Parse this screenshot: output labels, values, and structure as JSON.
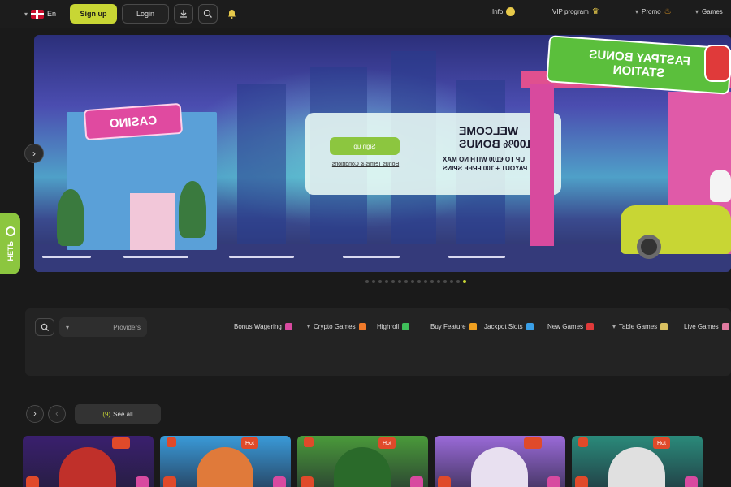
{
  "topbar": {
    "language": "En",
    "signup_label": "Sign up",
    "login_label": "Login",
    "nav": [
      {
        "label": "Info",
        "icon": "info-icon"
      },
      {
        "label": "VIP program",
        "icon": "crown-icon"
      },
      {
        "label": "Promo",
        "icon": "fire-icon"
      },
      {
        "label": "Games",
        "icon": "chevron-down-icon"
      }
    ]
  },
  "hero": {
    "promo_title": "WELCOME 100% BONUS",
    "promo_sub": "UP TO €100 WITH NO MAX PAYOUT + 100 FREE SPINS",
    "promo_button": "Sign up",
    "promo_terms": "Bonus Terms & Conditions",
    "casino_sign": "CASINO",
    "station_sign_line1": "FASTPAY BONUS",
    "station_sign_line2": "STATION"
  },
  "side_tab": {
    "label": "НЕТЬ"
  },
  "carousel": {
    "dot_count": 16,
    "active_index": 15
  },
  "categories": {
    "providers_placeholder": "Providers",
    "items": [
      {
        "label": "Bonus Wagering",
        "color": "#d84aa0"
      },
      {
        "label": "Crypto Games",
        "color": "#f07a2a",
        "dropdown": true
      },
      {
        "label": "Highroll",
        "color": "#3fbf5a"
      },
      {
        "label": "Buy Feature",
        "color": "#f0a020"
      },
      {
        "label": "Jackpot Slots",
        "color": "#3aa0e8"
      },
      {
        "label": "New Games",
        "color": "#e03a3a"
      },
      {
        "label": "Table Games",
        "color": "#d8c060",
        "dropdown": true
      },
      {
        "label": "Live Games",
        "color": "#e07aa0"
      }
    ]
  },
  "games_row": {
    "see_all_label": "See all",
    "see_all_count": "(9)",
    "hot_label": "Hot",
    "tiles": [
      {
        "name": "game-tile-1",
        "hot": false,
        "bg": "#3a1f6e",
        "char": "#c0302a"
      },
      {
        "name": "game-tile-2",
        "hot": true,
        "bg": "#3a9ad8",
        "char": "#e07a3a"
      },
      {
        "name": "game-tile-3",
        "hot": true,
        "bg": "#4a9a3a",
        "char": "#2a6a2a"
      },
      {
        "name": "game-tile-4",
        "hot": false,
        "bg": "#9a6ad8",
        "char": "#e8e0f0"
      },
      {
        "name": "game-tile-5",
        "hot": true,
        "bg": "#2a8a7a",
        "char": "#e0e0e0"
      }
    ]
  }
}
